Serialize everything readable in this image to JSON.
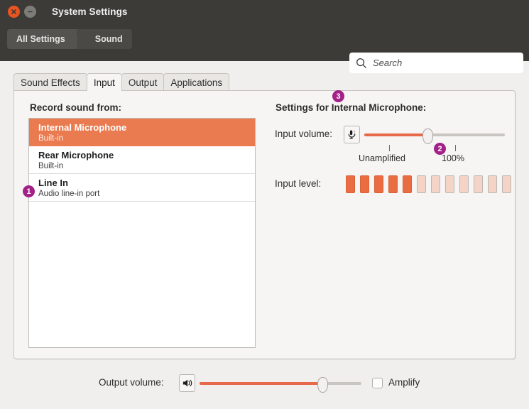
{
  "window": {
    "title": "System Settings",
    "close_icon": "close-icon",
    "minimize_icon": "minimize-icon"
  },
  "toolbar": {
    "breadcrumb": [
      "All Settings",
      "Sound"
    ],
    "search": {
      "icon": "search-icon",
      "placeholder": "Search",
      "value": ""
    }
  },
  "tabs": [
    {
      "label": "Sound Effects",
      "active": false
    },
    {
      "label": "Input",
      "active": true
    },
    {
      "label": "Output",
      "active": false
    },
    {
      "label": "Applications",
      "active": false
    }
  ],
  "left_panel": {
    "title": "Record sound from:",
    "devices": [
      {
        "name": "Internal Microphone",
        "subtitle": "Built-in",
        "selected": true
      },
      {
        "name": "Rear Microphone",
        "subtitle": "Built-in",
        "selected": false
      },
      {
        "name": "Line In",
        "subtitle": "Audio line-in port",
        "selected": false
      }
    ]
  },
  "right_panel": {
    "title": "Settings for Internal Microphone:",
    "input_volume": {
      "label": "Input volume:",
      "icon": "microphone-icon",
      "value_percent": 45,
      "scale_labels": [
        "Unamplified",
        "100%"
      ]
    },
    "input_level": {
      "label": "Input level:",
      "total_bars": 12,
      "active_bars": 5
    }
  },
  "bottom_bar": {
    "output_volume_label": "Output volume:",
    "speaker_icon": "speaker-volume-icon",
    "output_value_percent": 76,
    "amplify_label": "Amplify",
    "amplify_checked": false
  },
  "annotations": [
    {
      "number": "1",
      "target": "line-in-device-row"
    },
    {
      "number": "2",
      "target": "input-volume-100-percent-tick"
    },
    {
      "number": "3",
      "target": "settings-for-device-heading"
    }
  ],
  "colors": {
    "accent": "#e95420",
    "selection": "#ea7a50",
    "slider_fill": "#e8694a",
    "badge": "#a32088",
    "titlebar": "#3c3b37"
  }
}
